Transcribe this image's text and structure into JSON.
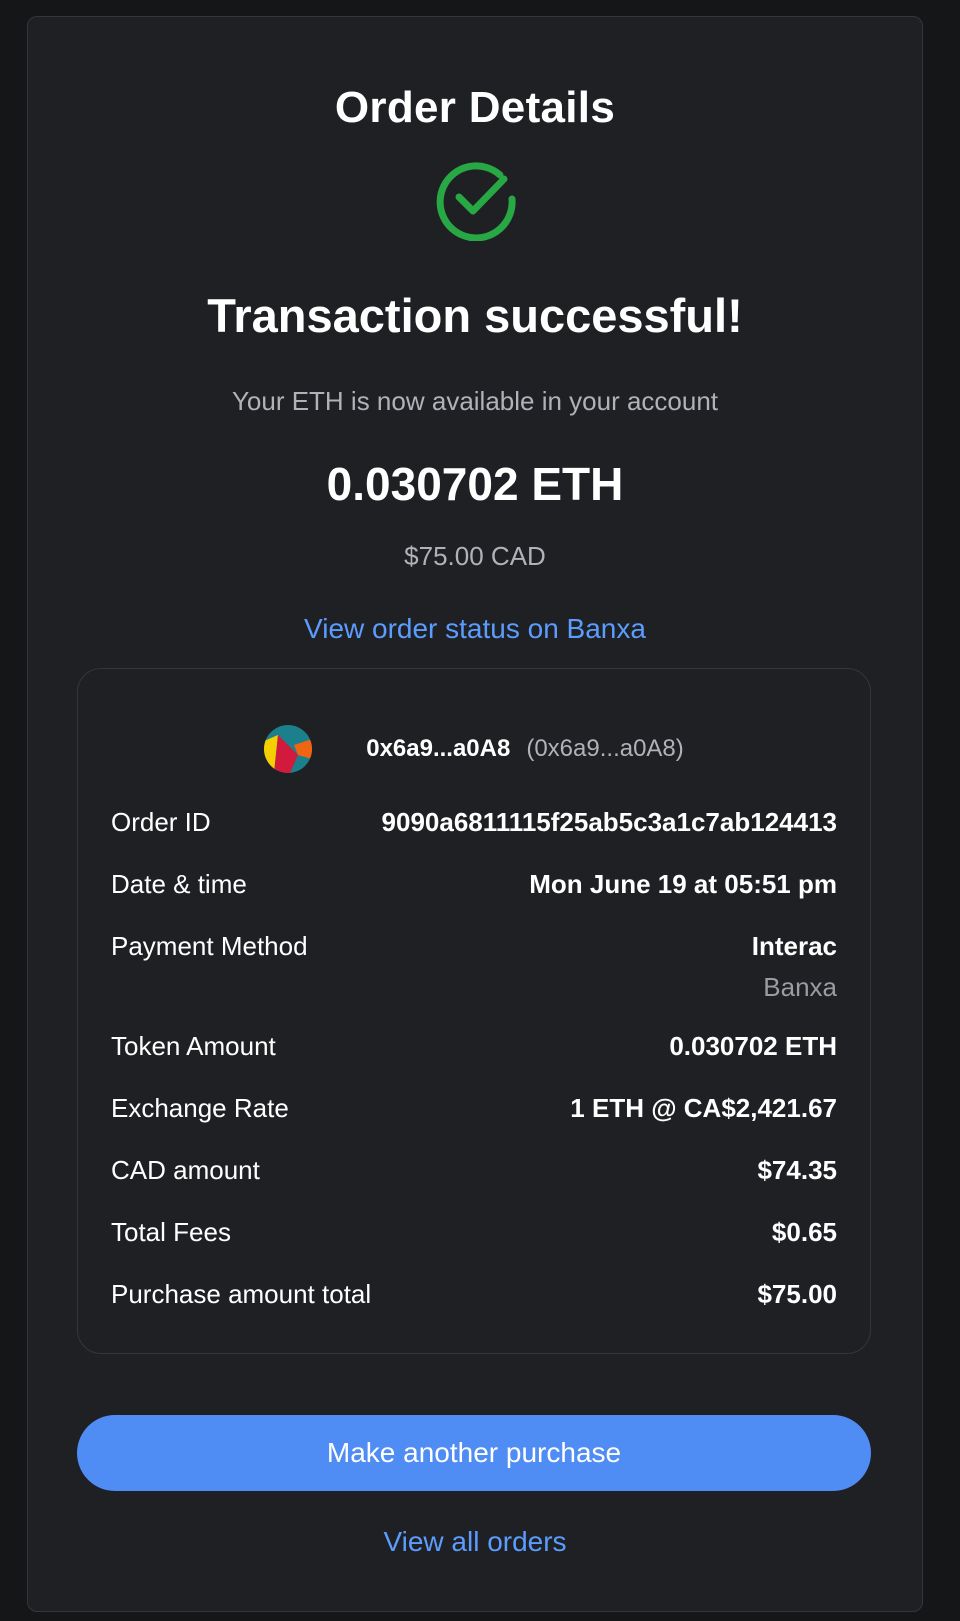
{
  "page": {
    "title": "Order Details",
    "status_icon": "check-circle-icon",
    "heading": "Transaction successful!",
    "subtitle": "Your ETH is now available in your account",
    "amount": "0.030702 ETH",
    "fiat_amount": "$75.00 CAD",
    "status_link": "View order status on Banxa"
  },
  "account": {
    "name": "0x6a9...a0A8",
    "address": "(0x6a9...a0A8)"
  },
  "details": [
    {
      "label": "Order ID",
      "value": "9090a6811115f25ab5c3a1c7ab124413"
    },
    {
      "label": "Date & time",
      "value": "Mon June 19 at 05:51 pm"
    },
    {
      "label": "Payment Method",
      "value": "Interac",
      "sub": "Banxa"
    },
    {
      "label": "Token Amount",
      "value": "0.030702 ETH"
    },
    {
      "label": "Exchange Rate",
      "value": "1 ETH @ CA$2,421.67"
    },
    {
      "label": "CAD amount",
      "value": "$74.35"
    },
    {
      "label": "Total Fees",
      "value": "$0.65"
    },
    {
      "label": "Purchase amount total",
      "value": "$75.00"
    }
  ],
  "actions": {
    "primary": "Make another purchase",
    "secondary": "View all orders"
  },
  "colors": {
    "background": "#1f2024",
    "success": "#28a745",
    "link": "#5b9cff",
    "button": "#4f8cf4"
  }
}
